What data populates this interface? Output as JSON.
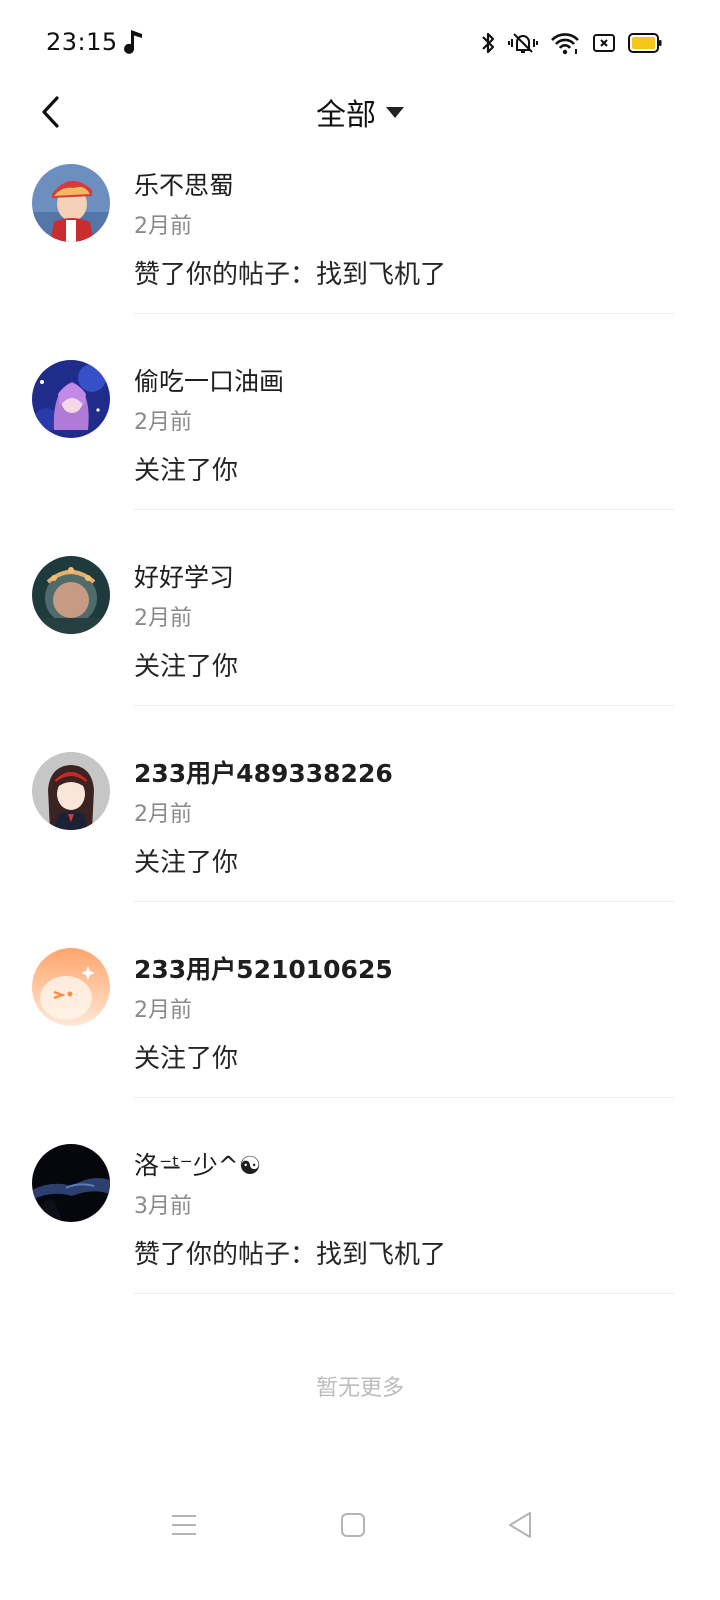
{
  "status_bar": {
    "time": "23:15",
    "icons": [
      "music-note-icon",
      "bluetooth-icon",
      "vibrate-icon",
      "wifi-icon",
      "sim-card-icon",
      "battery-icon"
    ],
    "battery_color": "#f5c518"
  },
  "header": {
    "title": "全部",
    "back_icon": "chevron-left-icon",
    "dropdown_icon": "caret-down-icon"
  },
  "notifications": [
    {
      "name": "乐不思蜀",
      "bold": false,
      "time": "2月前",
      "action": "赞了你的帖子：找到飞机了",
      "avatar": "avatar-red-cap-boy"
    },
    {
      "name": "偷吃一口油画",
      "bold": false,
      "time": "2月前",
      "action": "关注了你",
      "avatar": "avatar-purple-girl"
    },
    {
      "name": "好好学习",
      "bold": false,
      "time": "2月前",
      "action": "关注了你",
      "avatar": "avatar-dark-teal"
    },
    {
      "name": "233用户489338226",
      "bold": true,
      "time": "2月前",
      "action": "关注了你",
      "avatar": "avatar-default-girl"
    },
    {
      "name": "233用户521010625",
      "bold": true,
      "time": "2月前",
      "action": "关注了你",
      "avatar": "avatar-orange-blob"
    },
    {
      "name": "洛⁻ᵗ̶⁻少^☯",
      "bold": false,
      "time": "3月前",
      "action": "赞了你的帖子：找到飞机了",
      "avatar": "avatar-dark-sky"
    }
  ],
  "footer": {
    "no_more_text": "暂无更多"
  },
  "nav_bar": {
    "buttons": [
      "menu-icon",
      "home-square-icon",
      "back-triangle-icon"
    ]
  }
}
